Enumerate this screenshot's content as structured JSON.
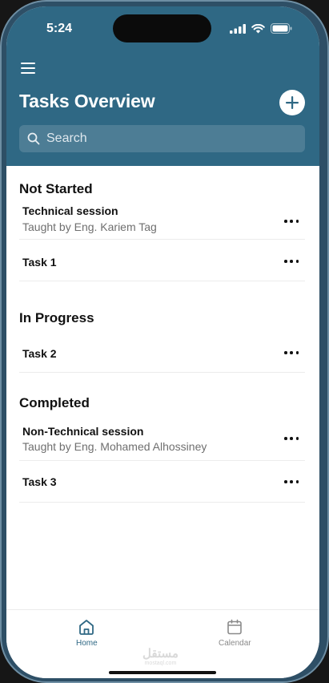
{
  "status": {
    "time": "5:24"
  },
  "header": {
    "title": "Tasks Overview",
    "search_placeholder": "Search"
  },
  "sections": [
    {
      "title": "Not Started",
      "tasks": [
        {
          "title": "Technical session",
          "subtitle": "Taught by Eng. Kariem Tag"
        },
        {
          "title": "Task 1"
        }
      ]
    },
    {
      "title": "In Progress",
      "tasks": [
        {
          "title": "Task 2"
        }
      ]
    },
    {
      "title": "Completed",
      "tasks": [
        {
          "title": "Non-Technical session",
          "subtitle": "Taught by Eng. Mohamed Alhossiney"
        },
        {
          "title": "Task 3"
        }
      ]
    }
  ],
  "nav": {
    "home": "Home",
    "calendar": "Calendar",
    "active": "home"
  },
  "watermark": {
    "logo": "مستقل",
    "url": "mostaql.com"
  },
  "colors": {
    "header_bg": "#2f6884",
    "accent": "#2f6884",
    "inactive": "#8a8a8a"
  }
}
